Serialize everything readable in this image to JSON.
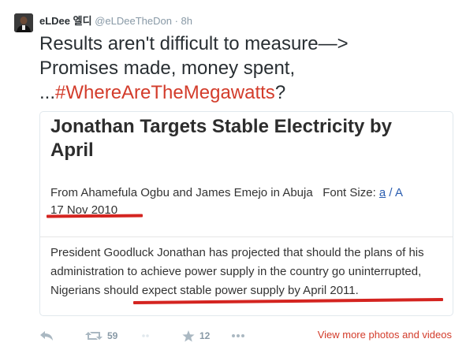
{
  "tweet": {
    "author_name": "eLDee 엘디",
    "handle": "@eLDeeTheDon",
    "separator": "·",
    "time": "8h",
    "text_line1": "Results aren't difficult to measure—>",
    "text_line2": "Promises made, money spent,",
    "text_line3_prefix": "...",
    "hashtag": "#WhereAreTheMegawatts",
    "text_line3_suffix": "?"
  },
  "card": {
    "title": "Jonathan Targets Stable Electricity by April",
    "byline": "From Ahamefula Ogbu and James Emejo in Abuja",
    "font_size_label": "Font Size:",
    "font_small": "a",
    "font_sep": " / ",
    "font_large": "A",
    "date": "17 Nov 2010",
    "body_part1": "President Goodluck Jonathan has projected that should the plans of his administration to achieve power supply in the country go uninterrupted, ",
    "body_highlight": "Nigerians should expect stable power supply by April 2011",
    "body_end": "."
  },
  "actions": {
    "retweets": "59",
    "favorites": "12",
    "more_link": "View more photos and videos"
  },
  "colors": {
    "hashtag": "#d33c2b",
    "highlight_underline": "#d42420",
    "link": "#2a5db0",
    "muted": "#8899a6"
  }
}
